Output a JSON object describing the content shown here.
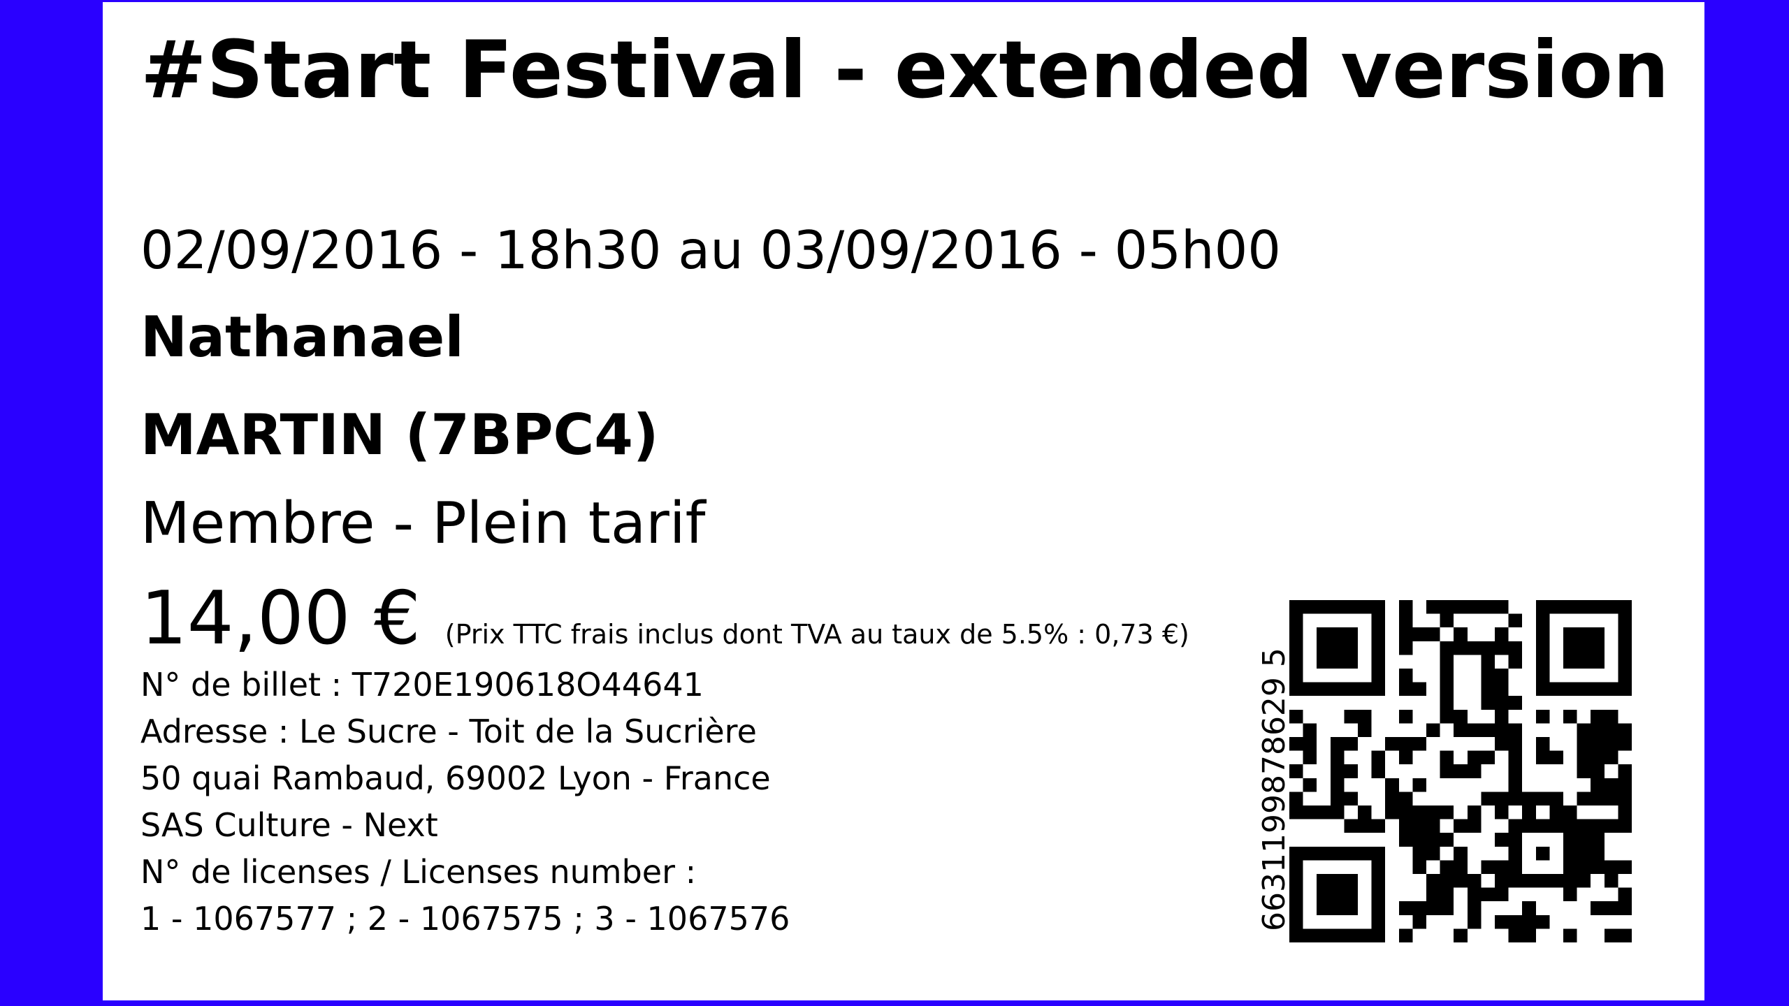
{
  "ticket": {
    "event_title": "#Start Festival - extended version",
    "event_dates": "02/09/2016 - 18h30 au 03/09/2016 - 05h00",
    "holder_first_name": "Nathanael",
    "holder_last_name": "MARTIN (7BPC4)",
    "tariff": "Membre - Plein tarif",
    "price": "14,00 €",
    "price_note": "(Prix TTC frais inclus dont TVA au taux de 5.5% : 0,73 €)",
    "ticket_number": "N° de billet : T720E190618O44641",
    "address_line1": "Adresse : Le Sucre - Toit de la Sucrière",
    "address_line2": "50 quai Rambaud, 69002 Lyon - France",
    "company": "SAS Culture - Next",
    "license_label": "N° de licenses / Licenses number :",
    "license_numbers": "1 - 1067577 ; 2 - 1067575 ; 3 - 1067576",
    "barcode_number": "6631199878629 5"
  },
  "colors": {
    "background_border": "#2a00ff",
    "ticket_background": "#ffffff",
    "text": "#000000"
  },
  "icons": {
    "qr": "qr-code-icon"
  }
}
